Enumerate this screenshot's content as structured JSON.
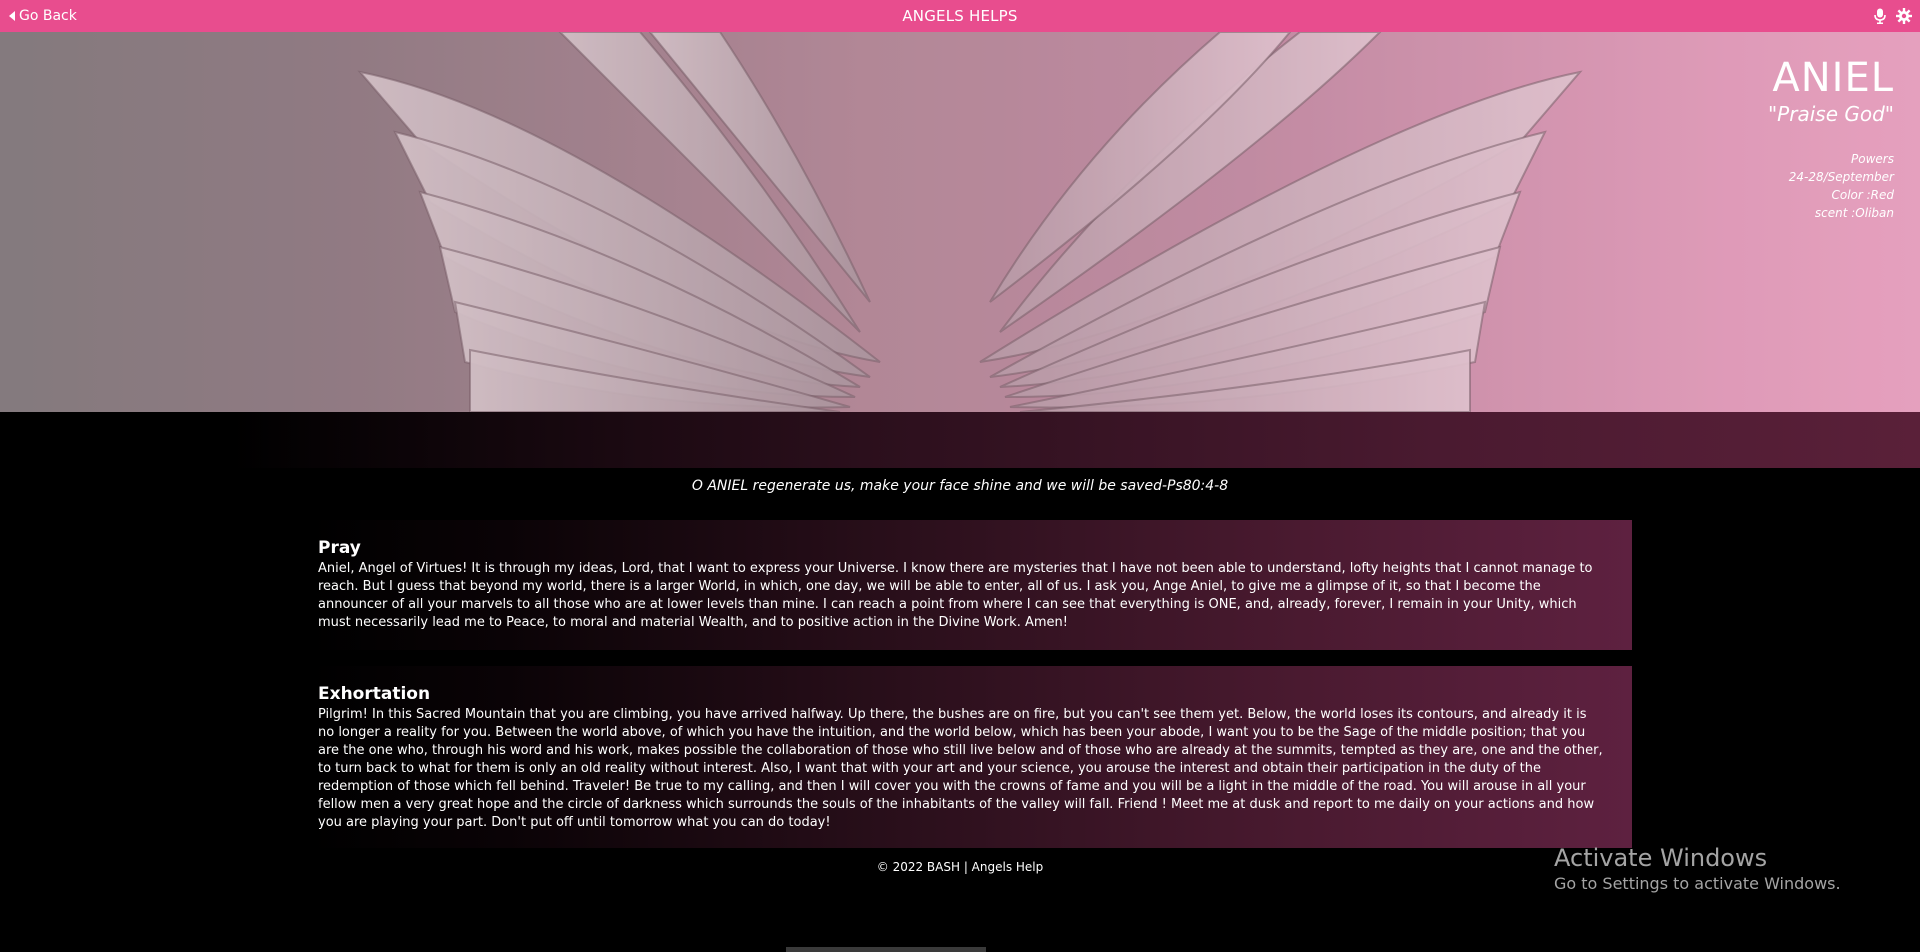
{
  "header": {
    "back_label": "Go Back",
    "title": "ANGELS HELPS",
    "icons": [
      "microphone-icon",
      "gear-icon"
    ]
  },
  "hero": {
    "name": "ANIEL",
    "meaning": "\"Praise God\"",
    "choir": "Powers",
    "dates": "24-28/September",
    "color": "Color :Red",
    "scent": "scent :Oliban"
  },
  "quote": "O ANIEL regenerate us, make your face shine and we will be saved-Ps80:4-8",
  "pray": {
    "title": "Pray",
    "body": "Aniel, Angel of Virtues! It is through my ideas, Lord, that I want to express your Universe. I know there are mysteries that I have not been able to understand, lofty heights that I cannot manage to reach. But I guess that beyond my world, there is a larger World, in which, one day, we will be able to enter, all of us. I ask you, Ange Aniel, to give me a glimpse of it, so that I become the announcer of all your marvels to all those who are at lower levels than mine. I can reach a point from where I can see that everything is ONE, and, already, forever, I remain in your Unity, which must necessarily lead me to Peace, to moral and material Wealth, and to positive action in the Divine Work. Amen!"
  },
  "exhortation": {
    "title": "Exhortation",
    "body": "Pilgrim! In this Sacred Mountain that you are climbing, you have arrived halfway. Up there, the bushes are on fire, but you can't see them yet. Below, the world loses its contours, and already it is no longer a reality for you. Between the world above, of which you have the intuition, and the world below, which has been your abode, I want you to be the Sage of the middle position; that you are the one who, through his word and his work, makes possible the collaboration of those who still live below and of those who are already at the summits, tempted as they are, one and the other, to turn back to what for them is only an old reality without interest. Also, I want that with your art and your science, you arouse the interest and obtain their participation in the duty of the redemption of those which fell behind. Traveler! Be true to my calling, and then I will cover you with the crowns of fame and you will be a light in the middle of the road. You will arouse in all your fellow men a very great hope and the circle of darkness which surrounds the souls of the inhabitants of the valley will fall. Friend ! Meet me at dusk and report to me daily on your actions and how you are playing your part. Don't put off until tomorrow what you can do today!"
  },
  "footer": "© 2022 BASH | Angels Help",
  "os_overlay": {
    "line1": "Activate Windows",
    "line2": "Go to Settings to activate Windows."
  },
  "colors": {
    "topbar": "#e84d8e",
    "hero_right": "#f1a9c8",
    "section_right": "#5e2140"
  }
}
